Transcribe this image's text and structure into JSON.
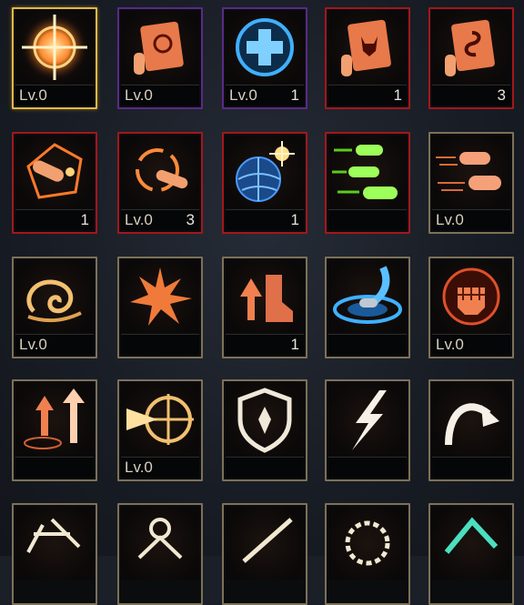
{
  "slots": [
    {
      "level": "Lv.0",
      "count": ""
    },
    {
      "level": "Lv.0",
      "count": ""
    },
    {
      "level": "Lv.0",
      "count": "1"
    },
    {
      "level": "",
      "count": "1"
    },
    {
      "level": "",
      "count": "3"
    },
    {
      "level": "",
      "count": "1"
    },
    {
      "level": "Lv.0",
      "count": "3"
    },
    {
      "level": "",
      "count": "1"
    },
    {
      "level": "",
      "count": ""
    },
    {
      "level": "Lv.0",
      "count": ""
    },
    {
      "level": "Lv.0",
      "count": ""
    },
    {
      "level": "",
      "count": ""
    },
    {
      "level": "",
      "count": "1"
    },
    {
      "level": "",
      "count": ""
    },
    {
      "level": "Lv.0",
      "count": ""
    },
    {
      "level": "",
      "count": ""
    },
    {
      "level": "Lv.0",
      "count": ""
    },
    {
      "level": "",
      "count": ""
    },
    {
      "level": "",
      "count": ""
    },
    {
      "level": "",
      "count": ""
    }
  ],
  "icons": [
    "crosshair-burst-icon",
    "bullet-scroll-moon-icon",
    "blue-cross-heal-icon",
    "bullet-scroll-demon-icon",
    "bullet-scroll-serpent-icon",
    "bullet-shatter-icon",
    "rotating-bullet-icon",
    "explosive-orb-icon",
    "green-bullets-icon",
    "fast-bullets-icon",
    "swirl-cloud-icon",
    "spike-burst-icon",
    "boot-arrows-icon",
    "blue-impact-ring-icon",
    "armored-fist-icon",
    "grenade-arrows-icon",
    "target-blast-icon",
    "shield-icon",
    "lightning-icon",
    "curved-arrow-icon"
  ],
  "colors": {
    "gold": "#e0b84a",
    "purple": "#5a2a86",
    "red": "#a3171b",
    "tan": "#7d7158",
    "glow_orange": "#ff7a2a",
    "glow_blue": "#3fb0ff",
    "glow_green": "#7dff3a"
  }
}
